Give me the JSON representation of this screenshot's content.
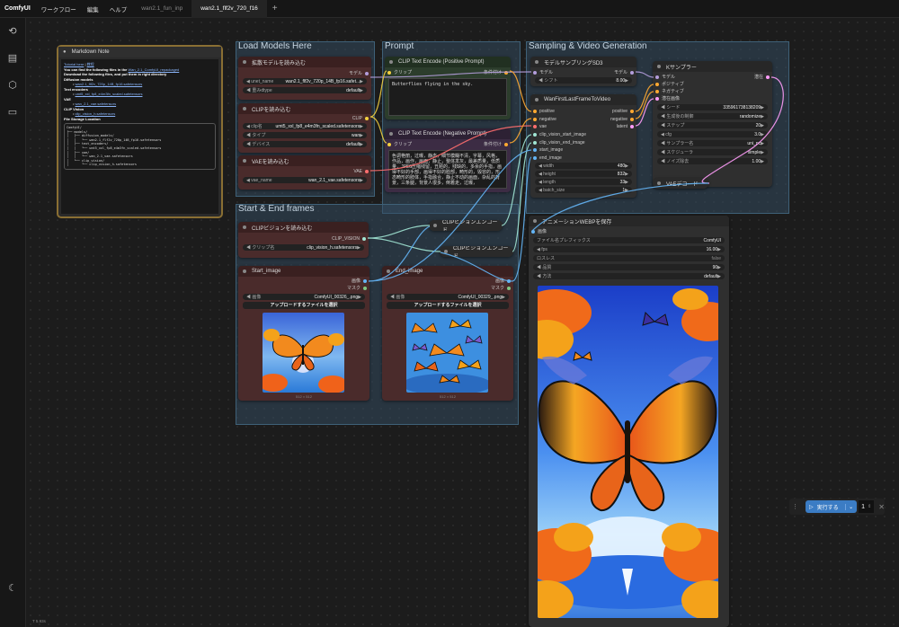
{
  "topbar": {
    "logo": "ComfyUI",
    "menu": [
      "ワークフロー",
      "編集",
      "ヘルプ"
    ],
    "tabs": [
      "wan2.1_fun_inp",
      "wan2.1_flf2v_720_f16"
    ],
    "plus": "+"
  },
  "groups": {
    "load": "Load Models Here",
    "prompt": "Prompt",
    "sampling": "Sampling & Video Generation",
    "frames": "Start & End frames"
  },
  "markdown": {
    "title": "Markdown Note",
    "tutorial_link": "Tutorial here",
    "tutorial_sep": "|",
    "tutorial_cn": "教程",
    "intro1": "You can find the following files in the",
    "intro_link": "Wan_2.1_ComfyUI_repackaged",
    "intro2": "Download the following files, and put them in right directory",
    "diffusion": "Diffusion models",
    "diffusion_file": "wan2.1_flf2v_720p_14B_fp16.safetensors",
    "text_enc": "Text encoders",
    "text_enc_file": "umt5_xxl_fp8_e4m3fn_scaled.safetensors",
    "vae": "VAE",
    "vae_file": "wan_2.1_vae.safetensors",
    "clipv": "CLIP Vision",
    "clipv_file": "clip_vision_h.safetensors",
    "storage": "File Storage Location",
    "tree": "ComfyUI/\n├── models/\n│   ├── diffusion_models/\n│   │   └── wan2.1_flf2v_720p_14B_fp16.safetensors\n│   ├── text_encoders/\n│   │   └── umt5_xxl_fp8_e4m3fn_scaled.safetensors\n│   ├── vae/\n│   │   └── wan_2.1_vae.safetensors\n│   └── clip_vision/\n│       └── clip_vision_h.safetensors"
  },
  "n_diff": {
    "title": "拡散モデルを読み込む",
    "out": "モデル",
    "unet_label": "unet_name",
    "unet_value": "wan2.1_flf2v_720p_14B_fp16.safet...",
    "dtype_label": "重みdtype",
    "dtype_value": "default"
  },
  "n_clip": {
    "title": "CLIPを読み込む",
    "out": "CLIP",
    "name_label": "clip名",
    "name_value": "umt5_xxl_fp8_e4m3fn_scaled.safetensors",
    "type_label": "タイプ",
    "type_value": "wan",
    "device_label": "デバイス",
    "device_value": "default"
  },
  "n_vae": {
    "title": "VAEを読み込む",
    "out": "VAE",
    "name_label": "vae_name",
    "name_value": "wan_2.1_vae.safetensors"
  },
  "n_pos": {
    "title": "CLIP Text Encode (Positive Prompt)",
    "in": "クリップ",
    "out": "条件付け",
    "text": "Butterflies flying in the sky."
  },
  "n_neg": {
    "title": "CLIP Text Encode (Negative Prompt)",
    "in": "クリップ",
    "out": "条件付け",
    "text": "色调艳丽，过曝，静态，细节模糊不清，字幕，风格，作品，画作，画面，静止，整体发灰，最差质量，低质量，JPEG压缩残留，丑陋的，残缺的，多余的手指，画得不好的手部，画得不好的脸部，畸形的，毁容的，形态畸形的肢体，手指融合，静止不动的画面，杂乱的背景，三条腿，背景人很多，倒着走，过曝，"
  },
  "n_sd3": {
    "title": "モデルサンプリングSD3",
    "in": "モデル",
    "out": "モデル",
    "shift_label": "シフト",
    "shift_value": "8.00"
  },
  "n_flf": {
    "title": "WanFirstLastFrameToVideo",
    "inputs": [
      "positive",
      "negative",
      "vae",
      "clip_vision_start_image",
      "clip_vision_end_image",
      "start_image",
      "end_image"
    ],
    "outputs": [
      "positive",
      "negative",
      "latent"
    ],
    "width_label": "width",
    "width_value": "480",
    "height_label": "height",
    "height_value": "832",
    "length_label": "length",
    "length_value": "33",
    "batch_label": "batch_size",
    "batch_value": "1"
  },
  "n_ks": {
    "title": "Kサンプラー",
    "inputs": [
      "モデル",
      "ポジティブ",
      "ネガティブ",
      "潜在画像"
    ],
    "out": "潜在",
    "seed_label": "シード",
    "seed_value": "335961738138209",
    "ctrl_label": "生成後の制御",
    "ctrl_value": "randomize",
    "steps_label": "ステップ",
    "steps_value": "20",
    "cfg_label": "cfg",
    "cfg_value": "3.0",
    "sampler_label": "サンプラー名",
    "sampler_value": "uni_pc",
    "sched_label": "スケジューラ",
    "sched_value": "simple",
    "denoise_label": "ノイズ除去",
    "denoise_value": "1.00"
  },
  "n_vaedec": {
    "title": "VAEデコード"
  },
  "n_cv": {
    "title": "CLIPビジョンを読み込む",
    "out": "CLIP_VISION",
    "label": "クリップ名",
    "value": "clip_vision_h.safetensors"
  },
  "n_cve1": {
    "title": "CLIPビジョンエンコード"
  },
  "n_cve2": {
    "title": "CLIPビジョンエンコード"
  },
  "n_start": {
    "title": "Start_image",
    "out_img": "画像",
    "out_mask": "マスク",
    "file_label": "画像",
    "file_value": "ComfyUI_00326_.png",
    "upload": "アップロードするファイルを選択",
    "dims": "512 × 512"
  },
  "n_end": {
    "title": "End_image",
    "out_img": "画像",
    "out_mask": "マスク",
    "file_label": "画像",
    "file_value": "ComfyUI_00329_.png",
    "upload": "アップロードするファイルを選択",
    "dims": "512 × 512"
  },
  "n_save": {
    "title": "アニメーションWEBPを保存",
    "in": "画像",
    "prefix_label": "ファイル名プレフィックス",
    "prefix_value": "ComfyUI",
    "fps_label": "fps",
    "fps_value": "16.00",
    "lossless_label": "ロスレス",
    "lossless_value": "false",
    "quality_label": "品質",
    "quality_value": "90",
    "method_label": "方法",
    "method_value": "default"
  },
  "runbar": {
    "label": "実行する",
    "count": "1"
  },
  "version": "T 5.93s",
  "colors": {
    "accent": "#3b7cc4",
    "group": "#344e64",
    "wire_clip": "#f4d03f",
    "wire_model": "#b39ddb",
    "wire_vae": "#ff6e6e",
    "wire_cond": "#ffa931",
    "wire_image": "#64b5f6",
    "wire_clipvision": "#a1e6d4"
  }
}
